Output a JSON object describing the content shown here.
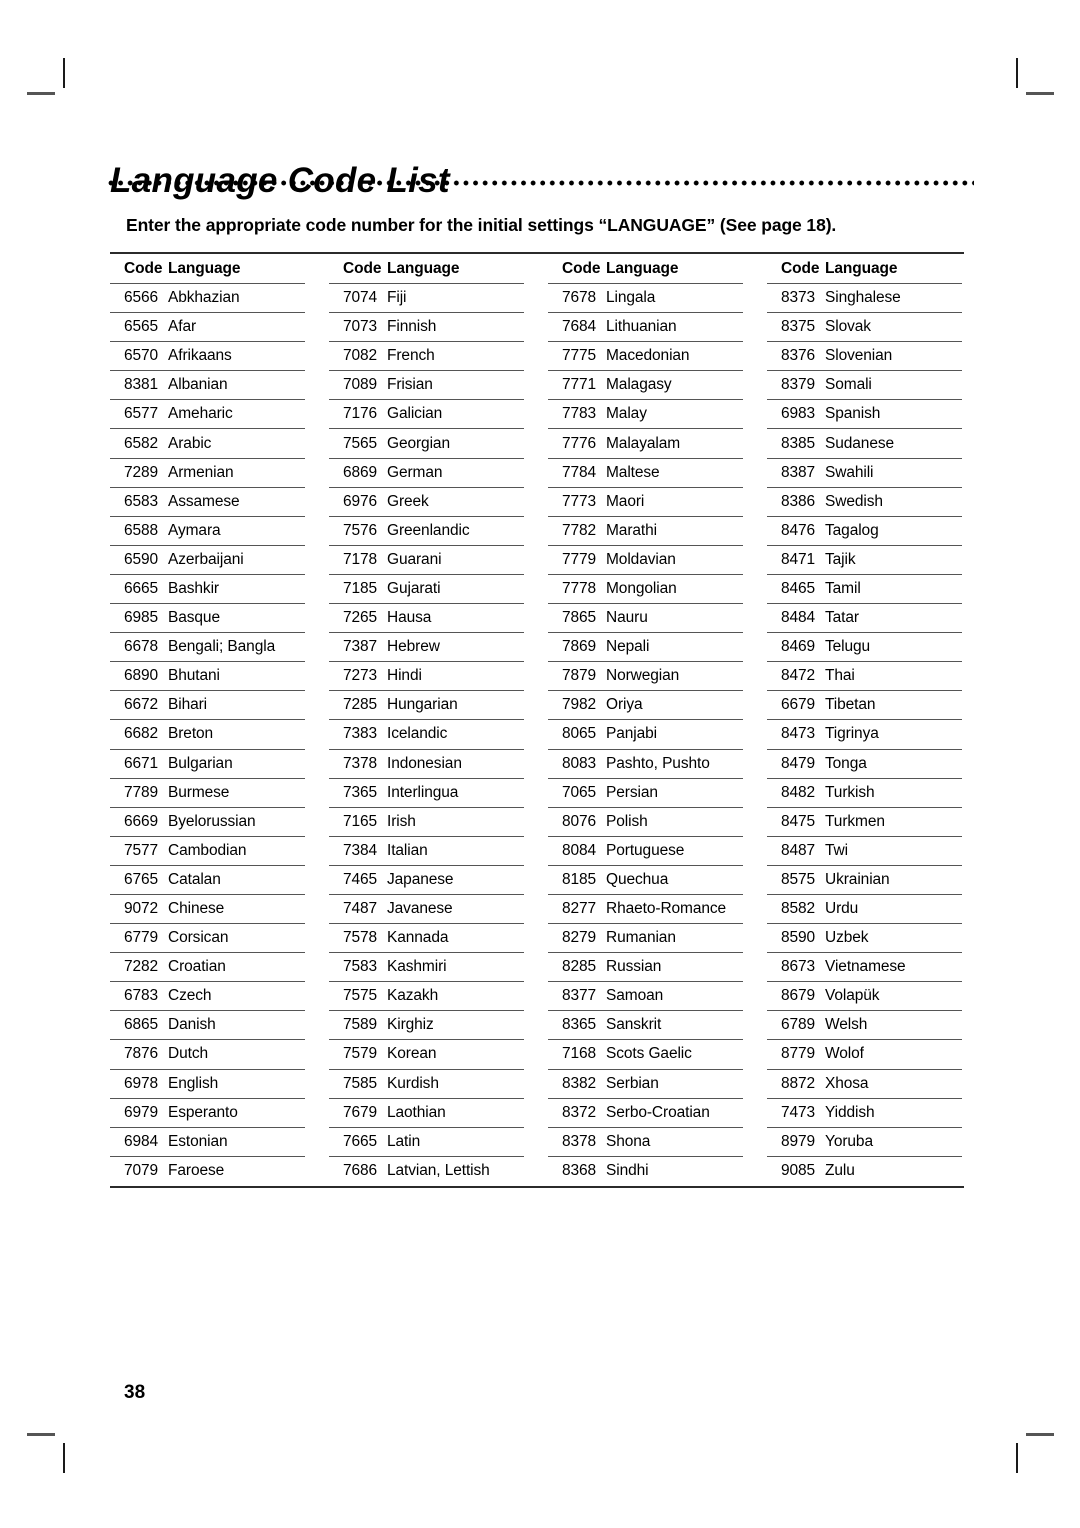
{
  "document": {
    "title": "Language Code List",
    "subtitle": "Enter the appropriate code number for the initial settings “LANGUAGE” (See page 18).",
    "page_number": "38"
  },
  "table": {
    "headers": {
      "code": "Code",
      "language": "Language"
    },
    "columns": [
      {
        "rows": [
          {
            "code": "6566",
            "language": "Abkhazian"
          },
          {
            "code": "6565",
            "language": "Afar"
          },
          {
            "code": "6570",
            "language": "Afrikaans"
          },
          {
            "code": "8381",
            "language": "Albanian"
          },
          {
            "code": "6577",
            "language": "Ameharic"
          },
          {
            "code": "6582",
            "language": "Arabic"
          },
          {
            "code": "7289",
            "language": "Armenian"
          },
          {
            "code": "6583",
            "language": "Assamese"
          },
          {
            "code": "6588",
            "language": "Aymara"
          },
          {
            "code": "6590",
            "language": "Azerbaijani"
          },
          {
            "code": "6665",
            "language": "Bashkir"
          },
          {
            "code": "6985",
            "language": "Basque"
          },
          {
            "code": "6678",
            "language": "Bengali; Bangla"
          },
          {
            "code": "6890",
            "language": "Bhutani"
          },
          {
            "code": "6672",
            "language": "Bihari"
          },
          {
            "code": "6682",
            "language": "Breton"
          },
          {
            "code": "6671",
            "language": "Bulgarian"
          },
          {
            "code": "7789",
            "language": "Burmese"
          },
          {
            "code": "6669",
            "language": "Byelorussian"
          },
          {
            "code": "7577",
            "language": "Cambodian"
          },
          {
            "code": "6765",
            "language": "Catalan"
          },
          {
            "code": "9072",
            "language": "Chinese"
          },
          {
            "code": "6779",
            "language": "Corsican"
          },
          {
            "code": "7282",
            "language": "Croatian"
          },
          {
            "code": "6783",
            "language": "Czech"
          },
          {
            "code": "6865",
            "language": "Danish"
          },
          {
            "code": "7876",
            "language": "Dutch"
          },
          {
            "code": "6978",
            "language": "English"
          },
          {
            "code": "6979",
            "language": "Esperanto"
          },
          {
            "code": "6984",
            "language": "Estonian"
          },
          {
            "code": "7079",
            "language": "Faroese"
          }
        ]
      },
      {
        "rows": [
          {
            "code": "7074",
            "language": "Fiji"
          },
          {
            "code": "7073",
            "language": "Finnish"
          },
          {
            "code": "7082",
            "language": "French"
          },
          {
            "code": "7089",
            "language": "Frisian"
          },
          {
            "code": "7176",
            "language": "Galician"
          },
          {
            "code": "7565",
            "language": "Georgian"
          },
          {
            "code": "6869",
            "language": "German"
          },
          {
            "code": "6976",
            "language": "Greek"
          },
          {
            "code": "7576",
            "language": "Greenlandic"
          },
          {
            "code": "7178",
            "language": "Guarani"
          },
          {
            "code": "7185",
            "language": "Gujarati"
          },
          {
            "code": "7265",
            "language": "Hausa"
          },
          {
            "code": "7387",
            "language": "Hebrew"
          },
          {
            "code": "7273",
            "language": "Hindi"
          },
          {
            "code": "7285",
            "language": "Hungarian"
          },
          {
            "code": "7383",
            "language": "Icelandic"
          },
          {
            "code": "7378",
            "language": "Indonesian"
          },
          {
            "code": "7365",
            "language": "Interlingua"
          },
          {
            "code": "7165",
            "language": "Irish"
          },
          {
            "code": "7384",
            "language": "Italian"
          },
          {
            "code": "7465",
            "language": "Japanese"
          },
          {
            "code": "7487",
            "language": "Javanese"
          },
          {
            "code": "7578",
            "language": "Kannada"
          },
          {
            "code": "7583",
            "language": "Kashmiri"
          },
          {
            "code": "7575",
            "language": "Kazakh"
          },
          {
            "code": "7589",
            "language": "Kirghiz"
          },
          {
            "code": "7579",
            "language": "Korean"
          },
          {
            "code": "7585",
            "language": "Kurdish"
          },
          {
            "code": "7679",
            "language": "Laothian"
          },
          {
            "code": "7665",
            "language": "Latin"
          },
          {
            "code": "7686",
            "language": "Latvian, Lettish"
          }
        ]
      },
      {
        "rows": [
          {
            "code": "7678",
            "language": "Lingala"
          },
          {
            "code": "7684",
            "language": "Lithuanian"
          },
          {
            "code": "7775",
            "language": "Macedonian"
          },
          {
            "code": "7771",
            "language": "Malagasy"
          },
          {
            "code": "7783",
            "language": "Malay"
          },
          {
            "code": "7776",
            "language": "Malayalam"
          },
          {
            "code": "7784",
            "language": "Maltese"
          },
          {
            "code": "7773",
            "language": "Maori"
          },
          {
            "code": "7782",
            "language": "Marathi"
          },
          {
            "code": "7779",
            "language": "Moldavian"
          },
          {
            "code": "7778",
            "language": "Mongolian"
          },
          {
            "code": "7865",
            "language": "Nauru"
          },
          {
            "code": "7869",
            "language": "Nepali"
          },
          {
            "code": "7879",
            "language": "Norwegian"
          },
          {
            "code": "7982",
            "language": "Oriya"
          },
          {
            "code": "8065",
            "language": "Panjabi"
          },
          {
            "code": "8083",
            "language": "Pashto, Pushto"
          },
          {
            "code": "7065",
            "language": "Persian"
          },
          {
            "code": "8076",
            "language": "Polish"
          },
          {
            "code": "8084",
            "language": "Portuguese"
          },
          {
            "code": "8185",
            "language": "Quechua"
          },
          {
            "code": "8277",
            "language": "Rhaeto-Romance"
          },
          {
            "code": "8279",
            "language": "Rumanian"
          },
          {
            "code": "8285",
            "language": "Russian"
          },
          {
            "code": "8377",
            "language": "Samoan"
          },
          {
            "code": "8365",
            "language": "Sanskrit"
          },
          {
            "code": "7168",
            "language": "Scots Gaelic"
          },
          {
            "code": "8382",
            "language": "Serbian"
          },
          {
            "code": "8372",
            "language": "Serbo-Croatian"
          },
          {
            "code": "8378",
            "language": "Shona"
          },
          {
            "code": "8368",
            "language": "Sindhi"
          }
        ]
      },
      {
        "rows": [
          {
            "code": "8373",
            "language": "Singhalese"
          },
          {
            "code": "8375",
            "language": "Slovak"
          },
          {
            "code": "8376",
            "language": "Slovenian"
          },
          {
            "code": "8379",
            "language": "Somali"
          },
          {
            "code": "6983",
            "language": "Spanish"
          },
          {
            "code": "8385",
            "language": "Sudanese"
          },
          {
            "code": "8387",
            "language": "Swahili"
          },
          {
            "code": "8386",
            "language": "Swedish"
          },
          {
            "code": "8476",
            "language": "Tagalog"
          },
          {
            "code": "8471",
            "language": "Tajik"
          },
          {
            "code": "8465",
            "language": "Tamil"
          },
          {
            "code": "8484",
            "language": "Tatar"
          },
          {
            "code": "8469",
            "language": "Telugu"
          },
          {
            "code": "8472",
            "language": "Thai"
          },
          {
            "code": "6679",
            "language": "Tibetan"
          },
          {
            "code": "8473",
            "language": "Tigrinya"
          },
          {
            "code": "8479",
            "language": "Tonga"
          },
          {
            "code": "8482",
            "language": "Turkish"
          },
          {
            "code": "8475",
            "language": "Turkmen"
          },
          {
            "code": "8487",
            "language": "Twi"
          },
          {
            "code": "8575",
            "language": "Ukrainian"
          },
          {
            "code": "8582",
            "language": "Urdu"
          },
          {
            "code": "8590",
            "language": "Uzbek"
          },
          {
            "code": "8673",
            "language": "Vietnamese"
          },
          {
            "code": "8679",
            "language": "Volapük"
          },
          {
            "code": "6789",
            "language": "Welsh"
          },
          {
            "code": "8779",
            "language": "Wolof"
          },
          {
            "code": "8872",
            "language": "Xhosa"
          },
          {
            "code": "7473",
            "language": "Yiddish"
          },
          {
            "code": "8979",
            "language": "Yoruba"
          },
          {
            "code": "9085",
            "language": "Zulu"
          }
        ]
      }
    ]
  }
}
